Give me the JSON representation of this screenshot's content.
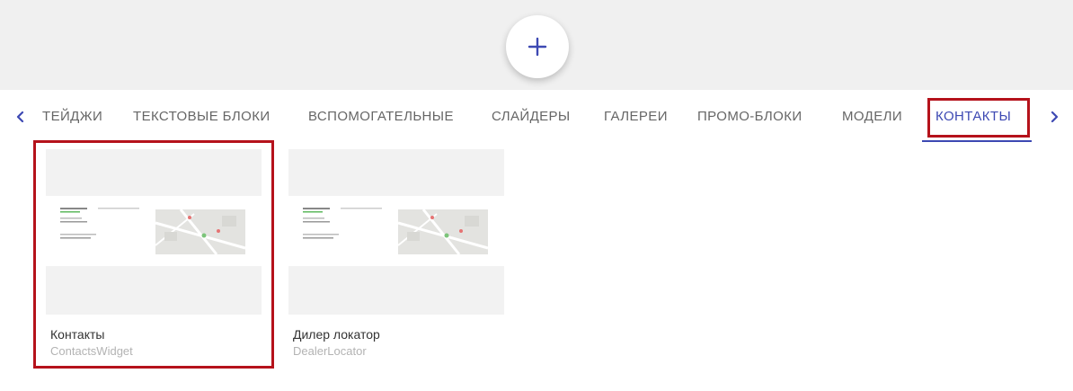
{
  "toolbar": {
    "add_icon": "plus-icon",
    "accent_color": "#3d49b3"
  },
  "tabs": {
    "prev_icon": "chevron-left-icon",
    "next_icon": "chevron-right-icon",
    "items": [
      {
        "label": "ТЕЙДЖИ"
      },
      {
        "label": "ТЕКСТОВЫЕ БЛОКИ"
      },
      {
        "label": "ВСПОМОГАТЕЛЬНЫЕ"
      },
      {
        "label": "СЛАЙДЕРЫ"
      },
      {
        "label": "ГАЛЕРЕИ"
      },
      {
        "label": "ПРОМО-БЛОКИ"
      },
      {
        "label": "МОДЕЛИ"
      },
      {
        "label": "КОНТАКТЫ"
      }
    ],
    "active": "КОНТАКТЫ"
  },
  "widgets": [
    {
      "title": "Контакты",
      "subtitle": "ContactsWidget"
    },
    {
      "title": "Дилер локатор",
      "subtitle": "DealerLocator"
    }
  ],
  "highlight_color": "#b5121b"
}
